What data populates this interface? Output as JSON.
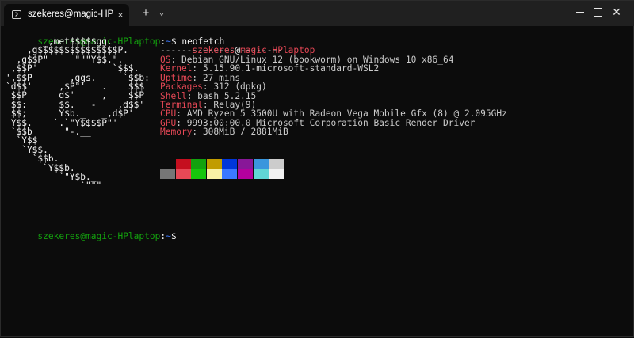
{
  "window": {
    "tab_title": "szekeres@magic-HPlaptop: ~",
    "tab_close_glyph": "×",
    "new_tab_glyph": "+",
    "dropdown_glyph": "⌄",
    "close_glyph": "✕"
  },
  "prompt": {
    "user_host": "szekeres@magic-HPlaptop",
    "colon": ":",
    "path": "~",
    "dollar": "$",
    "command": " neofetch"
  },
  "logo_lines": [
    "       _,met$$$$$gg.",
    "    ,g$$$$$$$$$$$$$$$P.",
    "  ,g$$P\"     \"\"\"Y$$.\".",
    " ,$$P'              `$$$.",
    "',$$P       ,ggs.     `$$b:",
    "`d$$'     ,$P\"'   .    $$$",
    " $$P      d$'     ,    $$P",
    " $$:      $$.   -    ,d$$'",
    " $$;      Y$b._   _,d$P'",
    " Y$$.    `.`\"Y$$$$P\"'",
    " `$$b      \"-.__",
    "  `Y$$",
    "   `Y$$.",
    "     `$$b.",
    "       `Y$$b.",
    "          `\"Y$b._",
    "              `\"\"\""
  ],
  "info": {
    "user": "szekeres",
    "at": "@",
    "host": "magic-HPlaptop",
    "separator": "-----------------------",
    "rows": [
      {
        "key": "OS",
        "value": "Debian GNU/Linux 12 (bookworm) on Windows 10 x86_64"
      },
      {
        "key": "Kernel",
        "value": "5.15.90.1-microsoft-standard-WSL2"
      },
      {
        "key": "Uptime",
        "value": "27 mins"
      },
      {
        "key": "Packages",
        "value": "312 (dpkg)"
      },
      {
        "key": "Shell",
        "value": "bash 5.2.15"
      },
      {
        "key": "Terminal",
        "value": "Relay(9)"
      },
      {
        "key": "CPU",
        "value": "AMD Ryzen 5 3500U with Radeon Vega Mobile Gfx (8) @ 2.095GHz"
      },
      {
        "key": "GPU",
        "value": "9993:00:00.0 Microsoft Corporation Basic Render Driver"
      },
      {
        "key": "Memory",
        "value": "308MiB / 2881MiB"
      }
    ],
    "kv_sep": ": "
  },
  "palette": {
    "top": [
      "#0c0c0c",
      "#c50f1f",
      "#13a10e",
      "#c19c00",
      "#0037da",
      "#881798",
      "#3a96dd",
      "#cccccc"
    ],
    "bottom": [
      "#767676",
      "#e74856",
      "#16c60c",
      "#f9f1a5",
      "#3b78ff",
      "#b4009e",
      "#61d6d6",
      "#f2f2f2"
    ]
  },
  "colors": {
    "background": "#0c0c0c",
    "titlebar": "#202020",
    "prompt_user": "#13a10e",
    "prompt_path": "#3b78ff",
    "info_key": "#e74856"
  }
}
